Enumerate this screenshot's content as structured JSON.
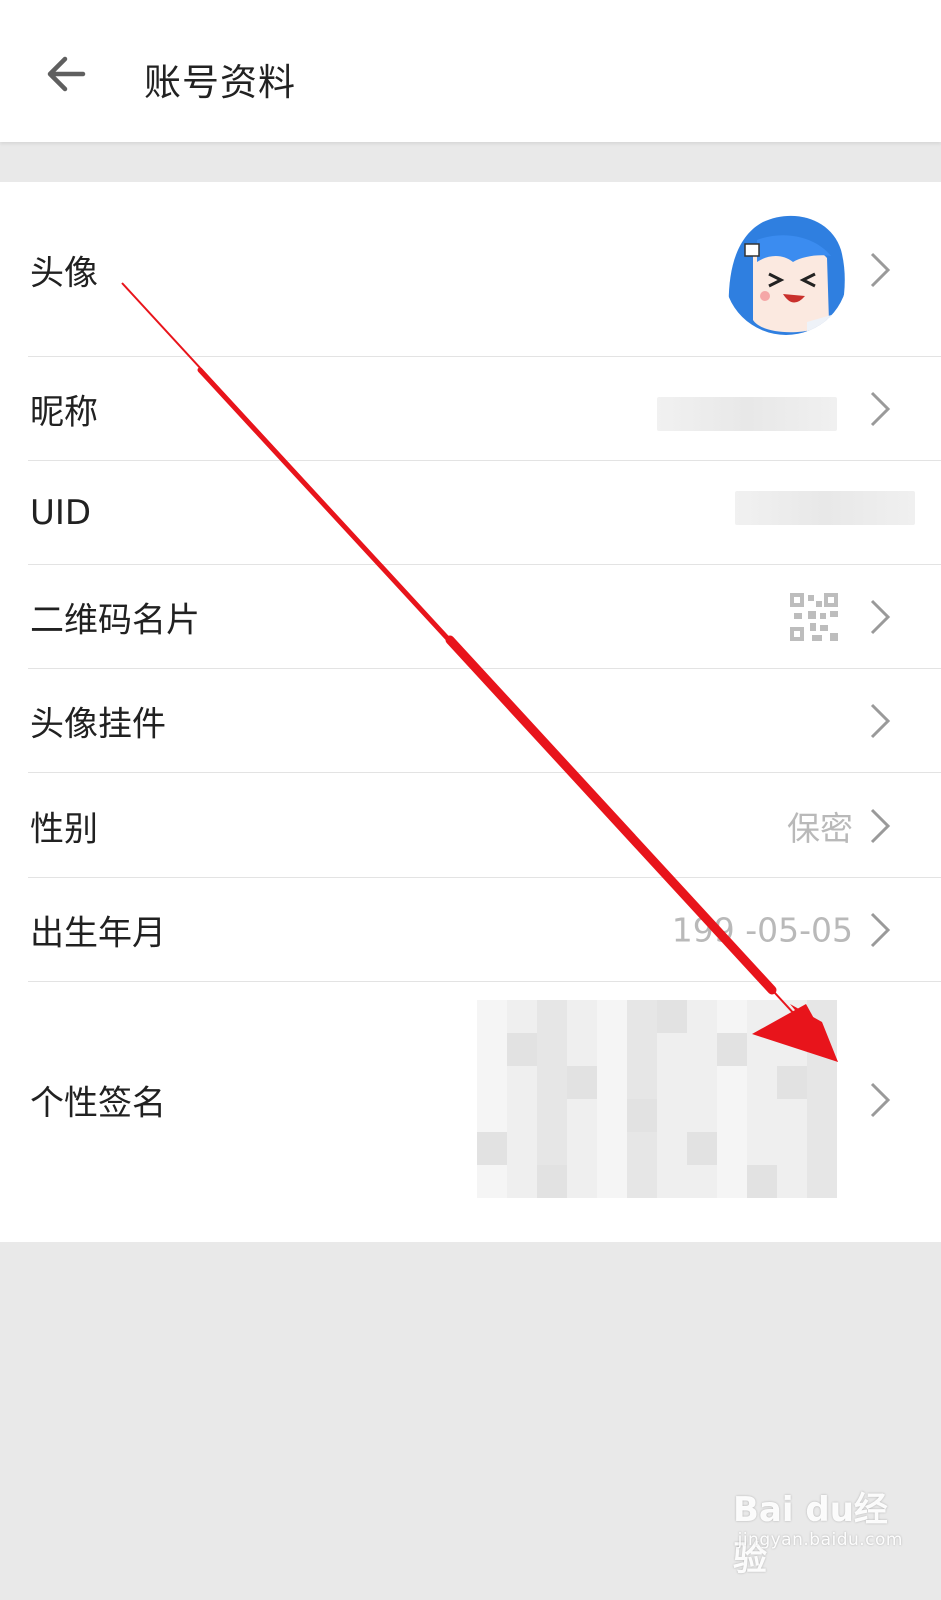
{
  "header": {
    "title": "账号资料",
    "back_icon": "arrow-left-icon"
  },
  "rows": [
    {
      "label": "头像",
      "value": ""
    },
    {
      "label": "昵称",
      "value": ""
    },
    {
      "label": "UID",
      "value": ""
    },
    {
      "label": "二维码名片",
      "value": ""
    },
    {
      "label": "头像挂件",
      "value": ""
    },
    {
      "label": "性别",
      "value": "保密"
    },
    {
      "label": "出生年月",
      "value": "199 -05-05"
    },
    {
      "label": "个性签名",
      "value": ""
    }
  ],
  "icons": {
    "chevron": "chevron-right-icon",
    "qr": "qr-code-icon",
    "avatar": "avatar-image"
  },
  "watermark": {
    "logo": "Bai du经验",
    "url": "jingyan.baidu.com"
  },
  "colors": {
    "background": "#e9e9e9",
    "surface": "#ffffff",
    "text_primary": "#212121",
    "text_secondary": "#b9b9b9",
    "annotation_arrow": "#e8141b",
    "avatar_hair": "#2f7fe0"
  }
}
